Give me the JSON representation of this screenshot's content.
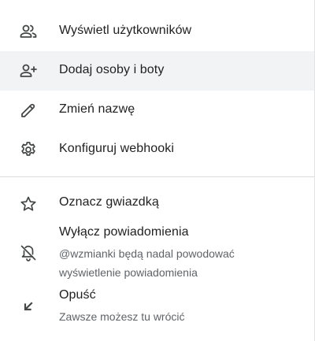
{
  "menu": {
    "items": [
      {
        "label": "Wyświetl użytkowników",
        "icon": "people-icon"
      },
      {
        "label": "Dodaj osoby i boty",
        "icon": "add-person-icon",
        "highlighted": true
      },
      {
        "label": "Zmień nazwę",
        "icon": "pencil-icon"
      },
      {
        "label": "Konfiguruj webhooki",
        "icon": "gear-icon"
      },
      {
        "label": "Oznacz gwiazdką",
        "icon": "star-icon"
      },
      {
        "label": "Wyłącz powiadomienia",
        "icon": "bell-off-icon",
        "sub1": "@wzmianki będą nadal powodować",
        "sub2": "wyświetlenie powiadomienia"
      },
      {
        "label": "Opuść",
        "icon": "arrow-down-left-icon",
        "sub1": "Zawsze możesz tu wrócić"
      }
    ]
  },
  "colors": {
    "highlight": "#f1f3f4",
    "text": "#1f1f1f",
    "secondary_text": "#5f6368",
    "icon": "#444746",
    "divider": "#dadce0"
  }
}
